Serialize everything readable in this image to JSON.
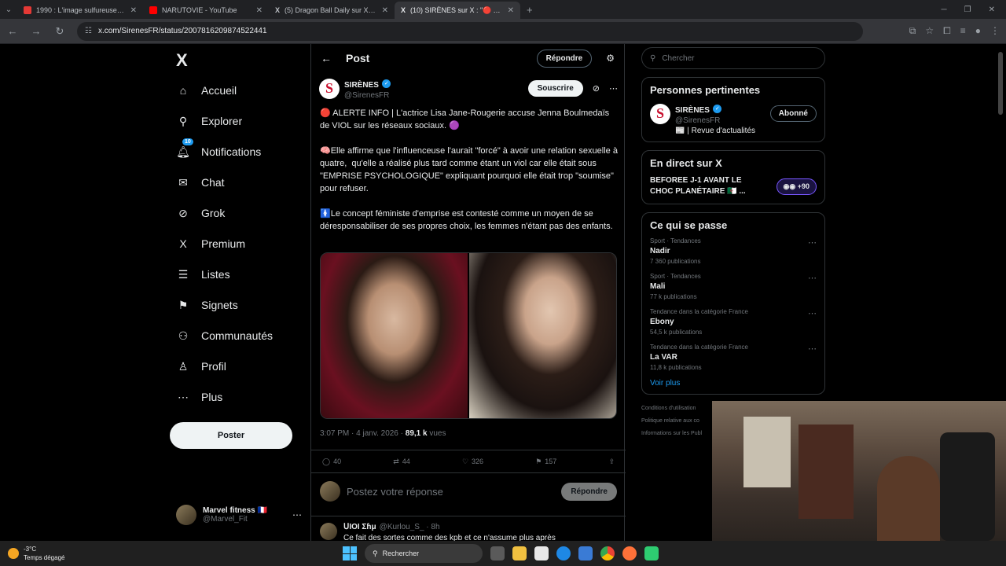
{
  "browser": {
    "tabs": [
      {
        "title": "1990 : L'image sulfureuse du ra",
        "color": "#e53935"
      },
      {
        "title": "NARUTOVIE - YouTube",
        "color": "#ff0000"
      },
      {
        "title": "(5) Dragon Ball Daily sur X : \"Ve",
        "color": "#ffffff"
      },
      {
        "title": "(10) SIRÈNES sur X : \"🔴 ALERT",
        "color": "#ffffff"
      }
    ],
    "url": "x.com/SirenesFR/status/2007816209874522441"
  },
  "nav": {
    "items": [
      {
        "label": "Accueil",
        "icon": "home-icon",
        "glyph": "⌂"
      },
      {
        "label": "Explorer",
        "icon": "search-icon",
        "glyph": "⚲"
      },
      {
        "label": "Notifications",
        "icon": "bell-icon",
        "glyph": "🔔︎"
      },
      {
        "label": "Chat",
        "icon": "mail-icon",
        "glyph": "✉"
      },
      {
        "label": "Grok",
        "icon": "grok-icon",
        "glyph": "⊘"
      },
      {
        "label": "Premium",
        "icon": "x-icon",
        "glyph": "X"
      },
      {
        "label": "Listes",
        "icon": "list-icon",
        "glyph": "☰"
      },
      {
        "label": "Signets",
        "icon": "bookmark-icon",
        "glyph": "⚑"
      },
      {
        "label": "Communautés",
        "icon": "people-icon",
        "glyph": "⚇"
      },
      {
        "label": "Profil",
        "icon": "person-icon",
        "glyph": "♙"
      },
      {
        "label": "Plus",
        "icon": "more-circle-icon",
        "glyph": "⋯"
      }
    ],
    "notif_badge": "10",
    "post_button": "Poster",
    "account": {
      "name": "Marvel fitness 🇫🇷",
      "handle": "@Marvel_Fit"
    }
  },
  "main": {
    "title": "Post",
    "reply_button": "Répondre",
    "tweet": {
      "author": "SIRÈNES",
      "handle": "@SirenesFR",
      "subscribe": "Souscrire",
      "paragraphs": [
        "🔴 ALERTE INFO | L'actrice Lisa Jane-Rougerie accuse Jenna Boulmedaïs de VIOL sur les réseaux sociaux. 🟣",
        "🧠Elle affirme que l'influenceuse l'aurait \"forcé\" à avoir une relation sexuelle à quatre,  qu'elle a réalisé plus tard comme étant un viol car elle était sous \"EMPRISE PSYCHOLOGIQUE\" expliquant pourquoi elle était trop \"soumise\" pour refuser.",
        "🚺Le concept féministe d'emprise est contesté comme un moyen de se déresponsabiliser de ses propres choix, les femmes n'étant pas des enfants."
      ],
      "time": "3:07 PM · 4 janv. 2026 · ",
      "views": "89,1 k",
      "views_label": " vues",
      "replies": "40",
      "retweets": "44",
      "likes": "326",
      "bookmarks": "157"
    },
    "reply_placeholder": "Postez votre réponse",
    "reply_submit": "Répondre",
    "next_reply": {
      "author": "ՍIOI Ʃɦμ",
      "handle": "@Kurlou_S_ · 8h",
      "text": "Ce fait des sortes comme des kpb et ce n'assume plus après"
    }
  },
  "right": {
    "search_placeholder": "Chercher",
    "relevant_title": "Personnes pertinentes",
    "relevant": {
      "name": "SIRÈNES",
      "handle": "@SirenesFR",
      "bio": "📰 | Revue d'actualités",
      "button": "Abonné"
    },
    "live_title": "En direct sur X",
    "live": {
      "text": "BEFOREE J-1 AVANT LE CHOC PLANÉTAIRE 🇩🇿 ...",
      "count": "+90"
    },
    "trends_title": "Ce qui se passe",
    "trends": [
      {
        "category": "Sport · Tendances",
        "name": "Nadir",
        "count": "7 360 publications"
      },
      {
        "category": "Sport · Tendances",
        "name": "Mali",
        "count": "77 k publications"
      },
      {
        "category": "Tendance dans la catégorie France",
        "name": "Ebony",
        "count": "54,5 k publications"
      },
      {
        "category": "Tendance dans la catégorie France",
        "name": "La VAR",
        "count": "11,8 k publications"
      }
    ],
    "see_more": "Voir plus",
    "footer": [
      "Conditions d'utilisation",
      "Politique relative aux co",
      "Informations sur les Publ"
    ]
  },
  "taskbar": {
    "temp": "-3°C",
    "weather": "Temps dégagé",
    "search": "Rechercher"
  },
  "colors": {
    "accent": "#1d9bf0",
    "bg": "#000000",
    "border": "#2f3336"
  }
}
